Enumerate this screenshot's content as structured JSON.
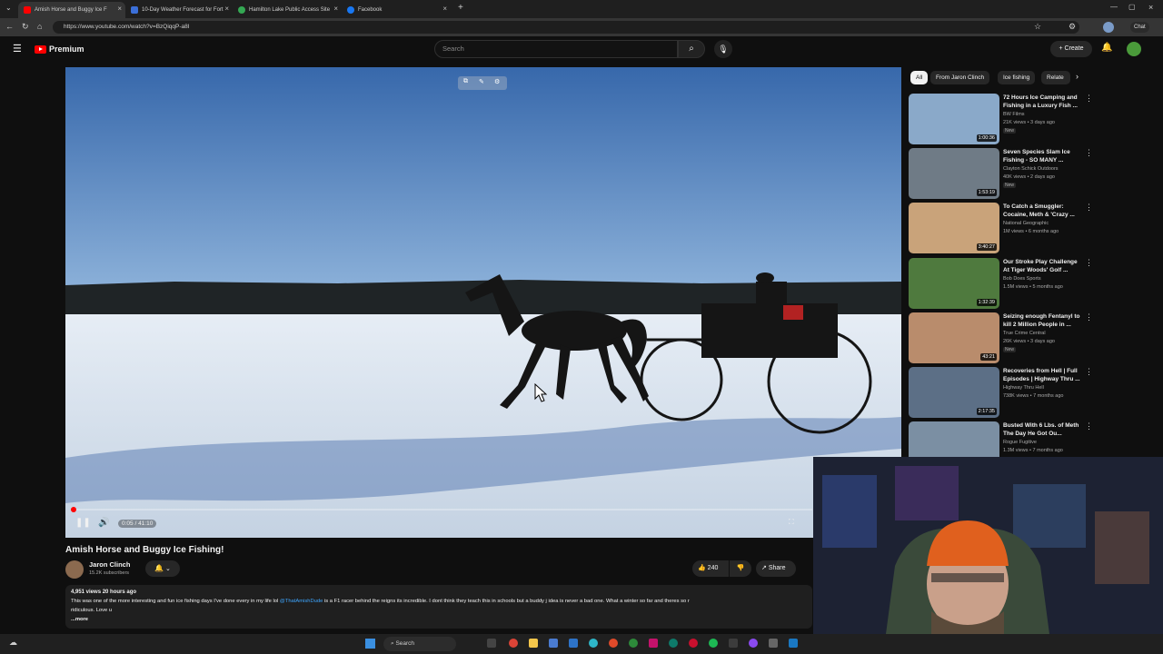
{
  "browser": {
    "tabs": [
      {
        "label": "Amish Horse and Buggy Ice F",
        "color": "#ff0000"
      },
      {
        "label": "10-Day Weather Forecast for Fort",
        "color": "#3b6fd8"
      },
      {
        "label": "Hamilton Lake Public Access Site",
        "color": "#34a853"
      },
      {
        "label": "Facebook",
        "color": "#1877f2"
      }
    ],
    "new_tab": "+",
    "url": "https://www.youtube.com/watch?v=BzQiqqP-a8I",
    "profile_label": "Chat"
  },
  "youtube": {
    "logo": "Premium",
    "search_placeholder": "Search",
    "create_label": "Create"
  },
  "player": {
    "time": "0:05 / 41:10",
    "progress": 0.002
  },
  "video": {
    "title": "Amish Horse and Buggy Ice Fishing!",
    "channel": "Jaron Clinch",
    "subscribers": "15.2K subscribers",
    "likes": "240",
    "share": "Share",
    "views": "4,951 views  20 hours ago",
    "desc_pre": "This was one of the more interesting and fun ice fishing days I've done every in my life lol ",
    "desc_mention": "@ThatAmishDude",
    "desc_post": " is a F1 racer behind the reigns its incredible. I dont think they teach this in schools but a buddy j idea is never a bad one. What a winter so far and theres so r",
    "desc_line2": "ridiculous. Love u",
    "more": "...more"
  },
  "chips": [
    {
      "label": "All",
      "selected": true
    },
    {
      "label": "From Jaron Clinch",
      "selected": false
    },
    {
      "label": "Ice fishing",
      "selected": false
    },
    {
      "label": "Relate",
      "selected": false
    }
  ],
  "recommendations": [
    {
      "title": "72 Hours Ice Camping and Fishing in a Luxury Fish ...",
      "channel": "BW Films",
      "meta": "21K views • 3 days ago",
      "badge": "New",
      "duration": "1:00:36",
      "thumb": "#8aa9c9"
    },
    {
      "title": "Seven Species Slam Ice Fishing - SO MANY ...",
      "channel": "Clayton Schick Outdoors",
      "meta": "40K views • 2 days ago",
      "badge": "New",
      "duration": "1:53:19",
      "thumb": "#6f7b86"
    },
    {
      "title": "To Catch a Smuggler: Cocaine, Meth & 'Crazy ...",
      "channel": "National Geographic",
      "meta": "1M views • 6 months ago",
      "badge": "",
      "duration": "3:40:27",
      "thumb": "#c9a37a"
    },
    {
      "title": "Our Stroke Play Challenge At Tiger Woods' Golf ...",
      "channel": "Bob Does Sports",
      "meta": "1.5M views • 5 months ago",
      "badge": "",
      "duration": "1:32:39",
      "thumb": "#4f7a3e"
    },
    {
      "title": "Seizing enough Fentanyl to kill 2 Million People in ...",
      "channel": "True Crime Central",
      "meta": "26K views • 3 days ago",
      "badge": "New",
      "duration": "43:21",
      "thumb": "#b98c6c"
    },
    {
      "title": "Recoveries from Hell | Full Episodes | Highway Thru ...",
      "channel": "Highway Thru Hell",
      "meta": "738K views • 7 months ago",
      "badge": "",
      "duration": "2:17:35",
      "thumb": "#5c6f86"
    },
    {
      "title": "Busted With 6 Lbs. of Meth The Day He Got Ou...",
      "channel": "Rogue Fugitive",
      "meta": "1.3M views • 7 months ago",
      "badge": "",
      "duration": "",
      "thumb": "#7b8fa3"
    }
  ],
  "taskbar": {
    "search": "Search"
  }
}
